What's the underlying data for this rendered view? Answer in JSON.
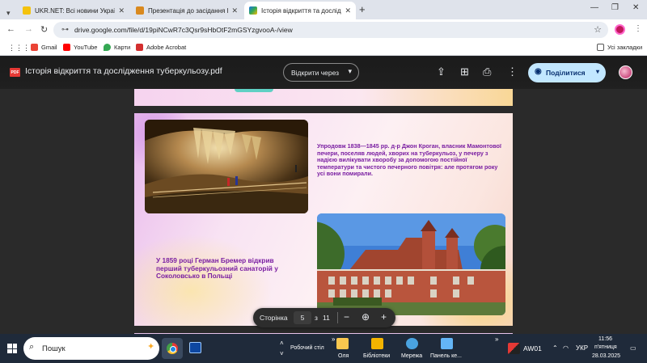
{
  "browser": {
    "tabs": [
      {
        "title": "UKR.NET: Всі новини України, ",
        "favicon_color": "#f4c20d"
      },
      {
        "title": "Презентація до засідання Бунт",
        "favicon_color": "#d9891e"
      },
      {
        "title": "Історія відкриття та дослідже",
        "favicon_color": "#1a73e8"
      }
    ],
    "url": "drive.google.com/file/d/19piNCwR7c3Qsr9sHbOtF2mGSYzgvooA-/view",
    "bookmarks": [
      {
        "label": "Gmail",
        "color": "#ea4335"
      },
      {
        "label": "YouTube",
        "color": "#ff0000"
      },
      {
        "label": "Карти",
        "color": "#34a853"
      },
      {
        "label": "Adobe Acrobat",
        "color": "#d32f2f"
      }
    ],
    "all_bookmarks": "Усі закладки"
  },
  "viewer": {
    "file_badge": "PDF",
    "title": "Історія відкриття та дослідження туберкульозу.pdf",
    "open_with": "Відкрити через",
    "share": "Поділитися"
  },
  "slide": {
    "text_top": "Упродовж 1838—1845 рр. д-р Джон Кроган, власник Мамонтової печери, поселяв людей, хворих на туберкульоз, у печеру з надією вилікувати хворобу за допомогою постійної температури та чистого печерного повітря: але протягом року усі вони помирали.",
    "text_bottom": "У 1859 році Герман Бремер відкрив перший туберкульозний санаторій у Соколовсько в Польщі",
    "text_color": "#7a1fa2"
  },
  "page_nav": {
    "label": "Сторінка",
    "current": "5",
    "of": "з",
    "total": "11"
  },
  "taskbar": {
    "search_placeholder": "Пошук",
    "pinned_desktop": "Робочий стіл",
    "items": [
      {
        "label": "Оля"
      },
      {
        "label": "Бібліотеки"
      },
      {
        "label": "Мережа"
      },
      {
        "label": "Панель ке..."
      }
    ],
    "tray_app": "AW01",
    "lang": "УКР",
    "time": "11:56",
    "day": "п'ятниця",
    "date": "28.03.2025"
  }
}
